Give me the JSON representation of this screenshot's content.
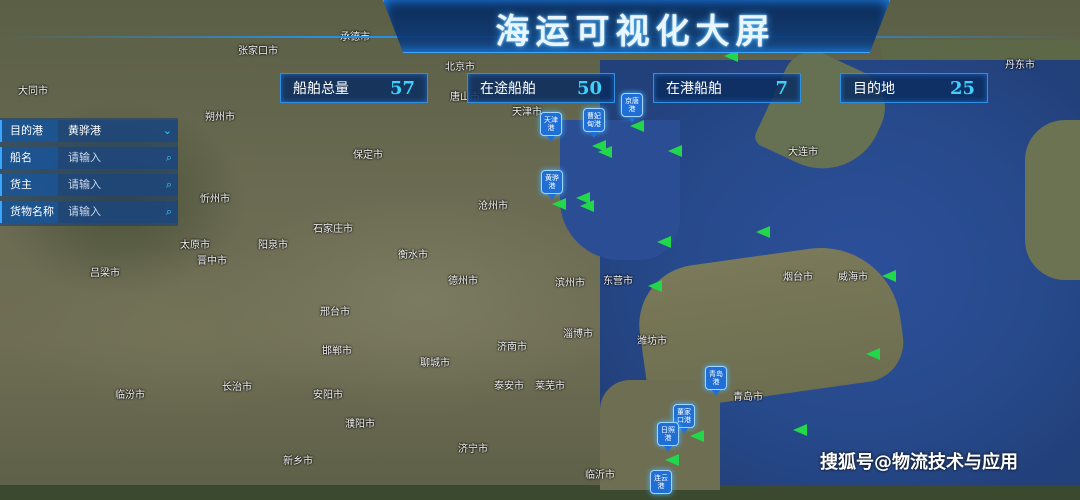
{
  "title": "海运可视化大屏",
  "stats": [
    {
      "label": "船舶总量",
      "value": "57"
    },
    {
      "label": "在途船舶",
      "value": "50"
    },
    {
      "label": "在港船舶",
      "value": "7"
    },
    {
      "label": "目的地",
      "value": "25"
    }
  ],
  "filters": [
    {
      "label": "目的港",
      "value": "黄骅港",
      "placeholder": "",
      "icon": "chevron-down-icon"
    },
    {
      "label": "船名",
      "value": "",
      "placeholder": "请输入",
      "icon": "search-icon"
    },
    {
      "label": "货主",
      "value": "",
      "placeholder": "请输入",
      "icon": "search-icon"
    },
    {
      "label": "货物名称",
      "value": "",
      "placeholder": "请输入",
      "icon": "search-icon"
    }
  ],
  "ports": [
    {
      "name": "天津港"
    },
    {
      "name": "曹妃甸港"
    },
    {
      "name": "京唐港"
    },
    {
      "name": "黄骅港"
    },
    {
      "name": "青岛港"
    },
    {
      "name": "董家口港"
    },
    {
      "name": "日照港"
    },
    {
      "name": "连云港"
    }
  ],
  "cities": [
    "大同市",
    "张家口市",
    "承德市",
    "丹东市",
    "忻州市",
    "朔州市",
    "保定市",
    "唐山市",
    "天津市",
    "大连市",
    "沧州市",
    "石家庄市",
    "太原市",
    "阳泉市",
    "晋中市",
    "吕梁市",
    "衡水市",
    "德州市",
    "滨州市",
    "东营市",
    "烟台市",
    "威海市",
    "邢台市",
    "邯郸市",
    "济南市",
    "淄博市",
    "潍坊市",
    "聊城市",
    "泰安市",
    "莱芜市",
    "临汾市",
    "长治市",
    "安阳市",
    "濮阳市",
    "济宁市",
    "临沂市",
    "新乡市",
    "青岛市",
    "北京市"
  ],
  "watermark": "搜狐号@物流技术与应用",
  "colors": {
    "ship": "#22d84a",
    "accent": "#3fd0ff",
    "panel": "#0a2d5f"
  }
}
